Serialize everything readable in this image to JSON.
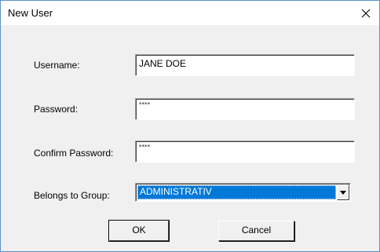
{
  "window": {
    "title": "New User",
    "close_glyph": "close-icon"
  },
  "form": {
    "username": {
      "label": "Username:",
      "value": "JANE DOE"
    },
    "password": {
      "label": "Password:",
      "value": "****"
    },
    "confirm_password": {
      "label": "Confirm Password:",
      "value": "****"
    },
    "group": {
      "label": "Belongs to Group:",
      "selected": "ADMINISTRATIV"
    }
  },
  "buttons": {
    "ok": "OK",
    "cancel": "Cancel"
  },
  "colors": {
    "selection": "#0078d7",
    "dialog_bg": "#f0f0f0",
    "border_accent": "#5a8fc8"
  }
}
